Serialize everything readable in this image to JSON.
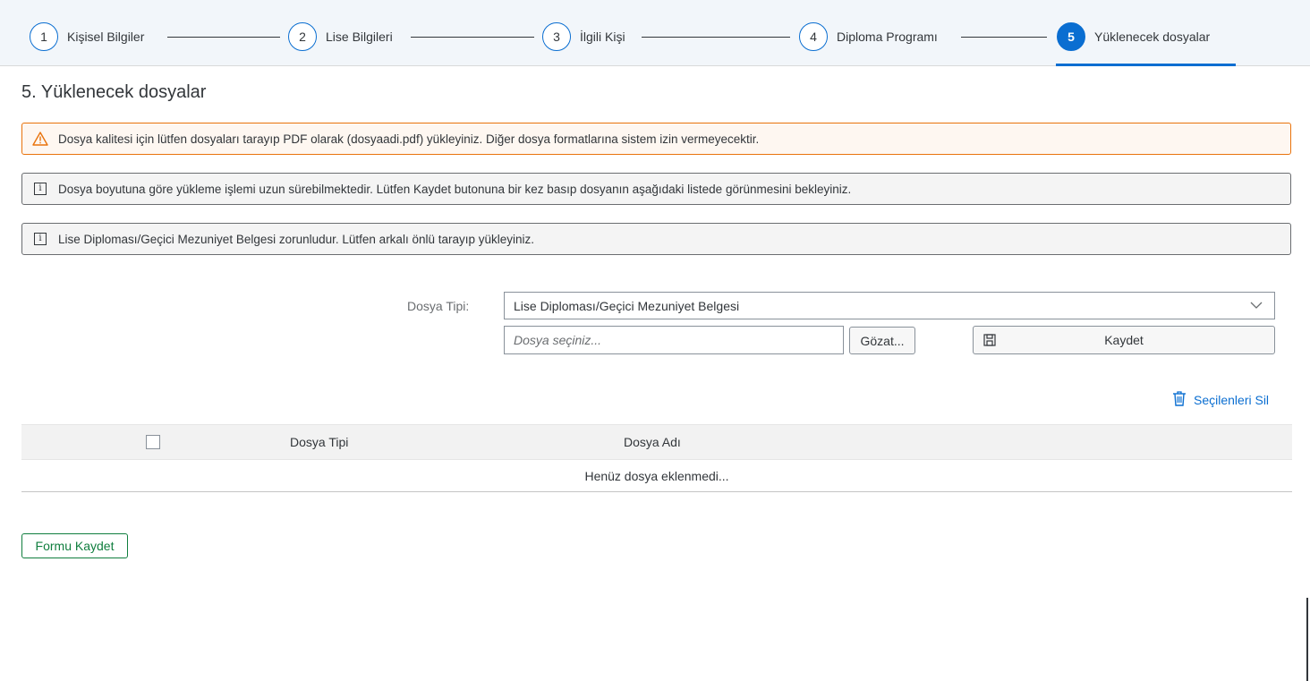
{
  "wizard": {
    "steps": [
      {
        "number": "1",
        "label": "Kişisel Bilgiler"
      },
      {
        "number": "2",
        "label": "Lise Bilgileri"
      },
      {
        "number": "3",
        "label": "İlgili Kişi"
      },
      {
        "number": "4",
        "label": "Diploma Programı"
      },
      {
        "number": "5",
        "label": "Yüklenecek dosyalar",
        "active": true
      }
    ],
    "accent_color": "#0a6ed1"
  },
  "page": {
    "title": "5. Yüklenecek dosyalar"
  },
  "messages": {
    "warning": "Dosya kalitesi için lütfen dosyaları tarayıp PDF olarak (dosyaadi.pdf) yükleyiniz. Diğer dosya formatlarına sistem izin vermeyecektir.",
    "info1": "Dosya boyutuna göre yükleme işlemi uzun sürebilmektedir. Lütfen Kaydet butonuna bir kez basıp dosyanın aşağıdaki listede görünmesini bekleyiniz.",
    "info2": "Lise Diploması/Geçici Mezuniyet Belgesi zorunludur. Lütfen arkalı önlü tarayıp yükleyiniz."
  },
  "upload": {
    "type_label": "Dosya Tipi:",
    "type_value": "Lise Diploması/Geçici Mezuniyet Belgesi",
    "file_placeholder": "Dosya seçiniz...",
    "browse_label": "Gözat...",
    "save_label": "Kaydet"
  },
  "table": {
    "delete_selected": "Seçilenleri Sil",
    "columns": [
      "Dosya Tipi",
      "Dosya Adı"
    ],
    "empty_text": "Henüz dosya eklenmedi..."
  },
  "footer": {
    "save_form_label": "Formu Kaydet",
    "save_form_color": "#107e3e"
  }
}
